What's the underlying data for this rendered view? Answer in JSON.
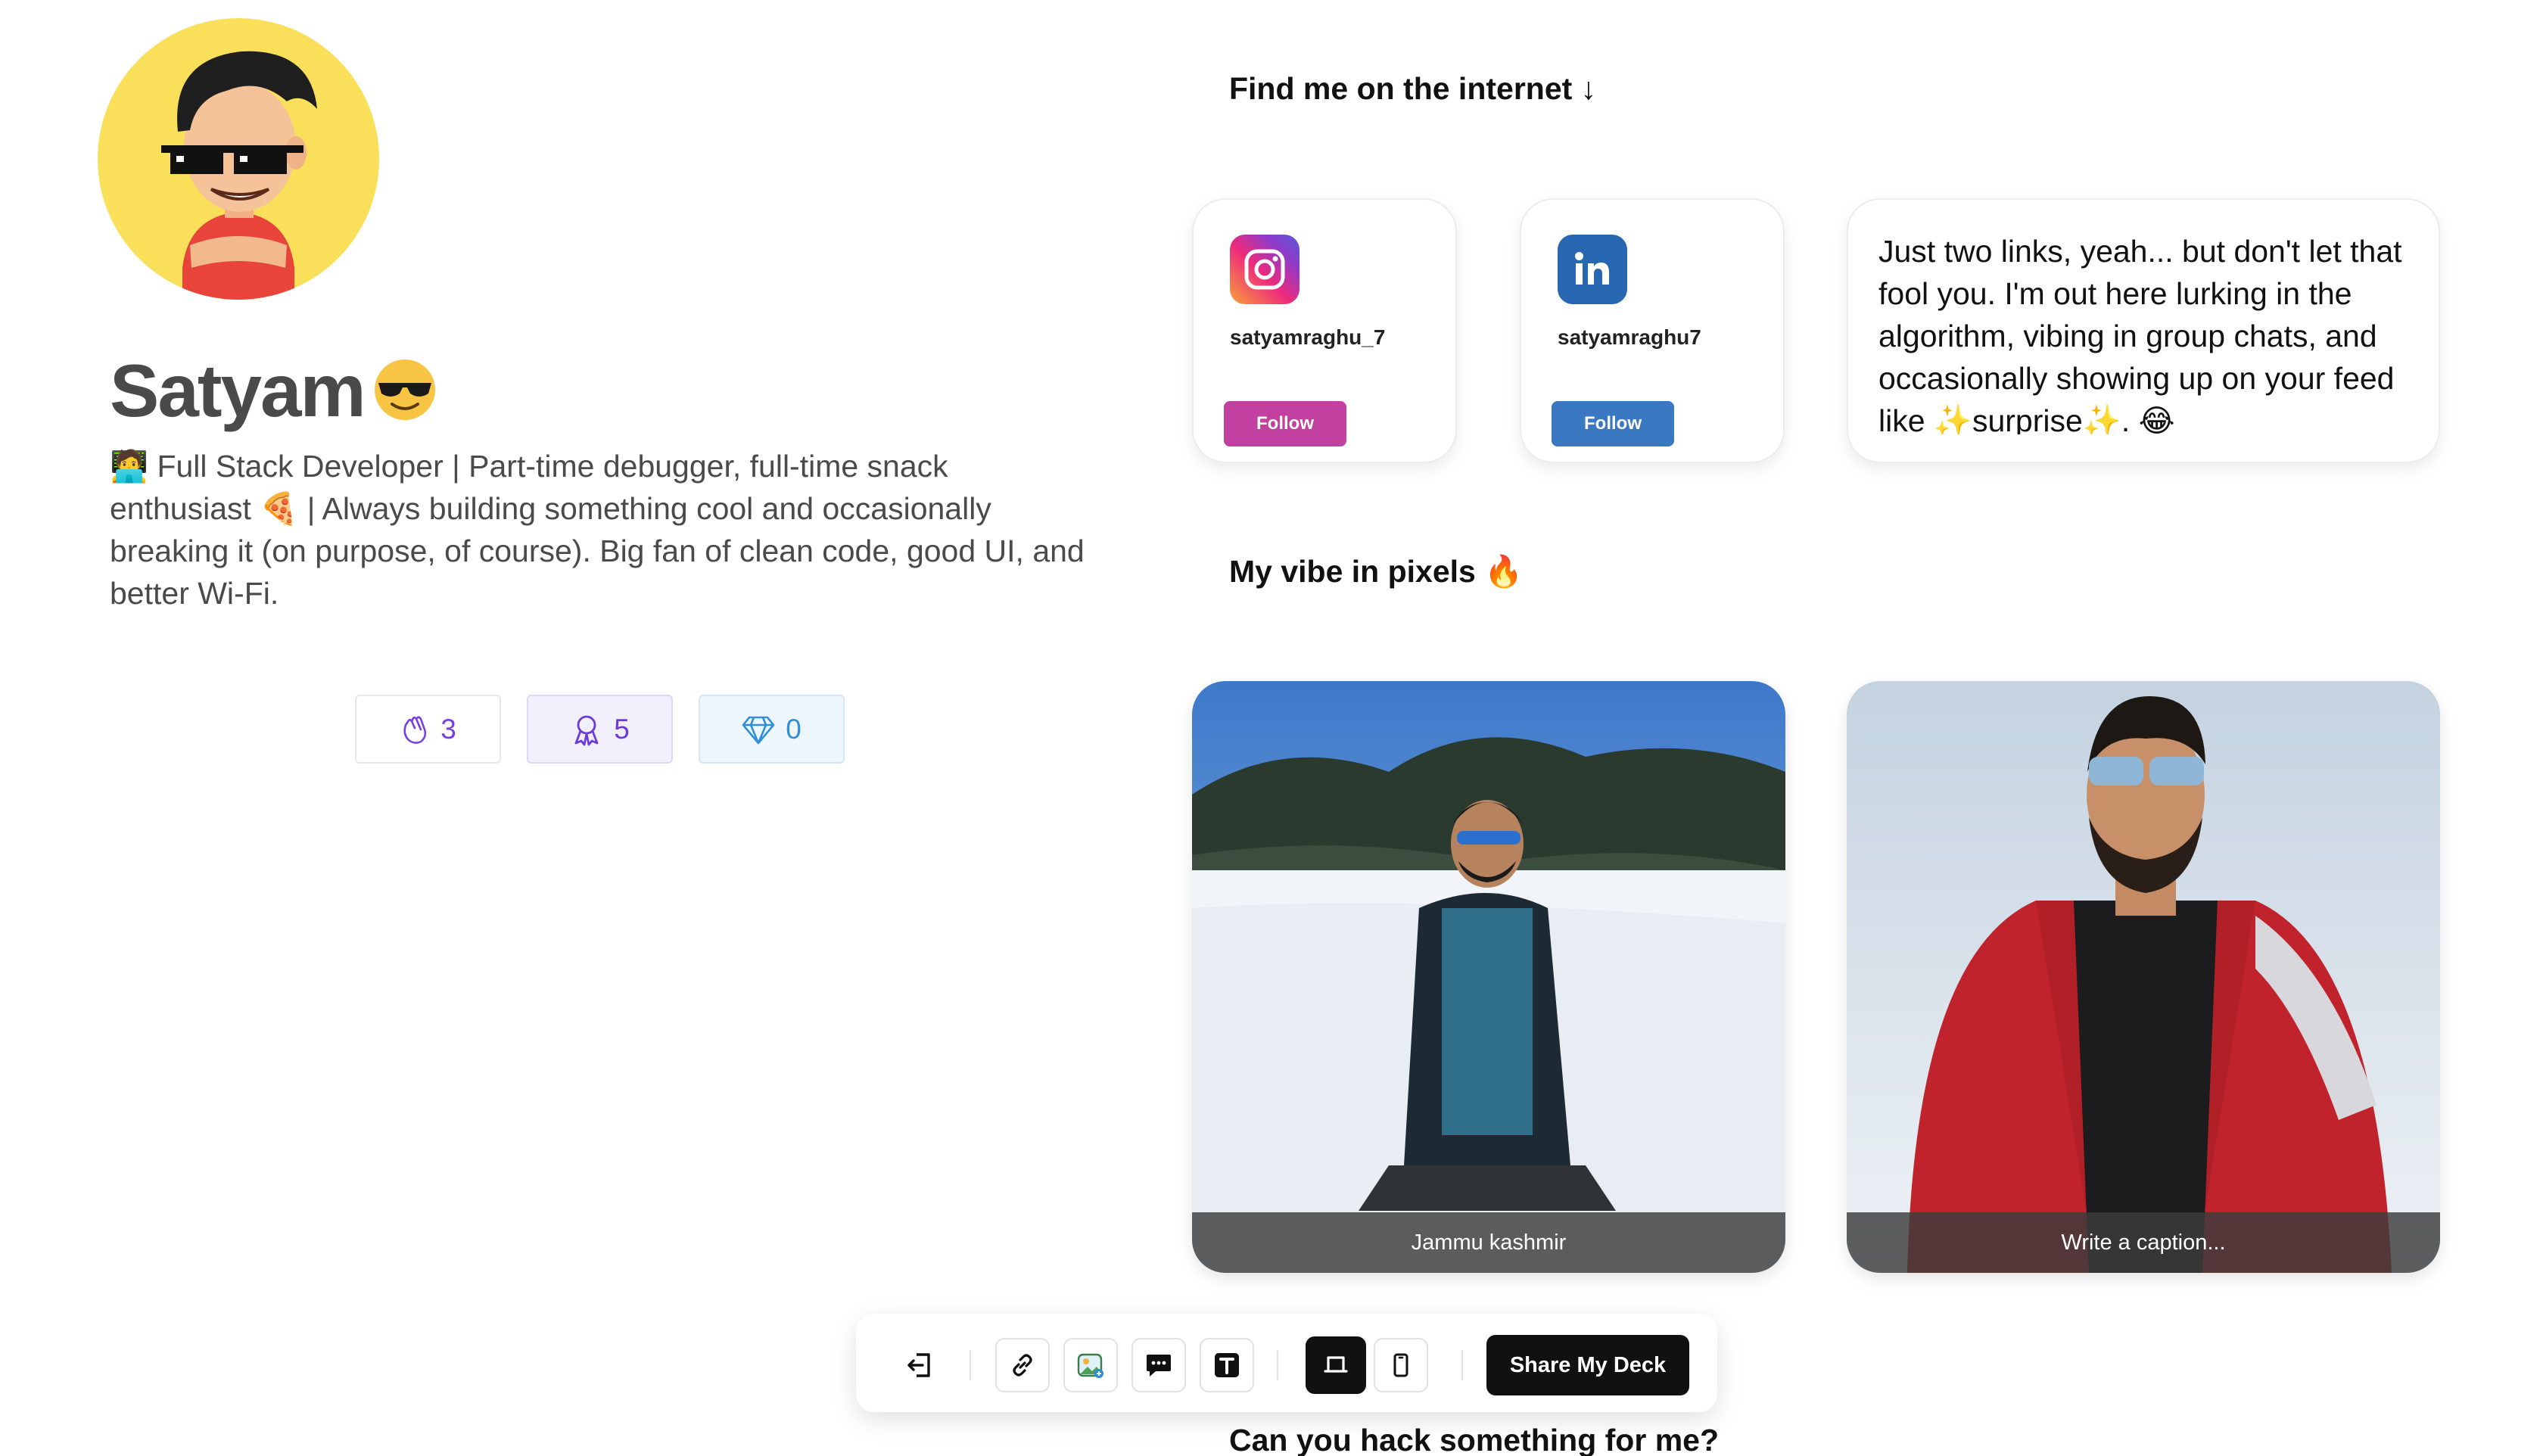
{
  "profile": {
    "name": "Satyam",
    "name_emoji": "😎",
    "bio_emoji_1": "🧑‍💻",
    "bio_part1": " Full Stack Developer | Part-time debugger, full-time snack enthusiast ",
    "bio_emoji_2": "🍕",
    "bio_part2": " | Always building something cool and occasionally breaking it (on purpose, of course). Big fan of clean code, good UI, and better Wi-Fi."
  },
  "stats": [
    {
      "icon": "clap-icon",
      "value": "3"
    },
    {
      "icon": "award-icon",
      "value": "5"
    },
    {
      "icon": "gem-icon",
      "value": "0"
    }
  ],
  "headings": {
    "internet": "Find me on the internet ↓",
    "pixels": "My vibe in pixels 🔥",
    "hack": "Can you hack something for me?"
  },
  "socials": [
    {
      "platform": "instagram",
      "handle": "satyamraghu_7",
      "button": "Follow",
      "color": "#c2409f"
    },
    {
      "platform": "linkedin",
      "handle": "satyamraghu7",
      "button": "Follow",
      "color": "#3a78c2"
    }
  ],
  "note": {
    "text": "Just two links, yeah... but don't let that fool you. I'm out here lurking in the algorithm, vibing in group chats, and occasionally showing up on your feed like ✨surprise✨. 😂"
  },
  "photos": [
    {
      "caption": "Jammu kashmir"
    },
    {
      "caption": "Write a caption..."
    }
  ],
  "toolbar": {
    "share_label": "Share My Deck",
    "items": [
      "logout-icon",
      "link-icon",
      "image-icon",
      "comment-icon",
      "text-icon",
      "desktop-view-icon",
      "mobile-view-icon"
    ]
  }
}
